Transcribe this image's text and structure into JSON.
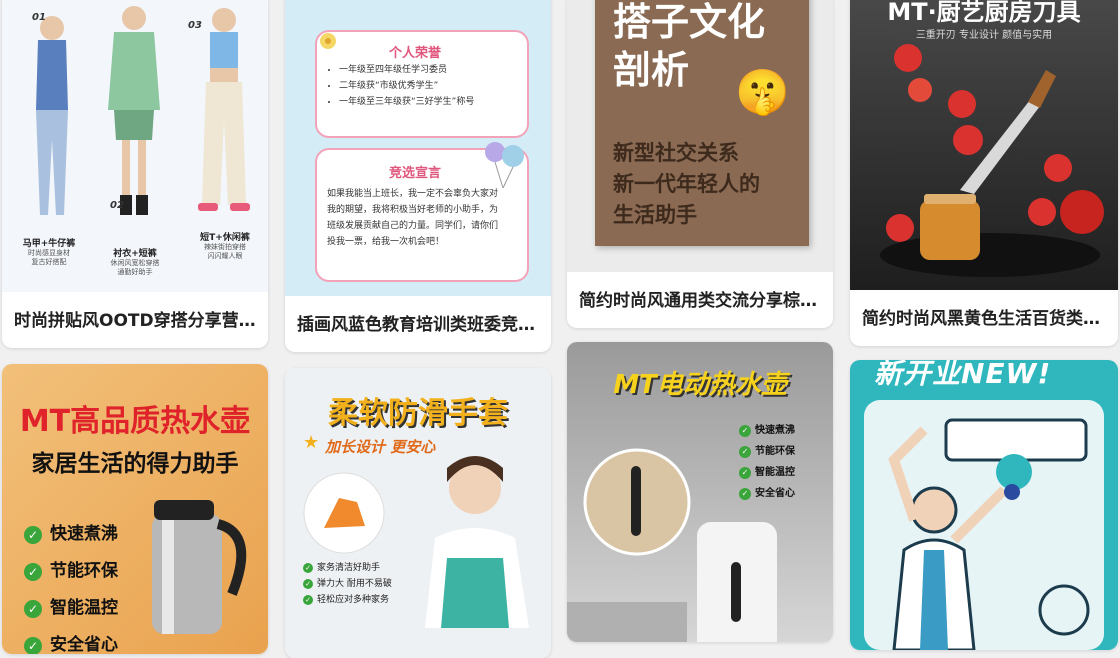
{
  "cards": [
    {
      "caption": "时尚拼贴风OOTD穿搭分享营…",
      "numbers": [
        "01",
        "02",
        "03"
      ],
      "labels": [
        {
          "title": "马甲+牛仔裤",
          "sub": "时尚感显身材\n复古好搭配"
        },
        {
          "title": "衬衣+短裤",
          "sub": "休闲风宽松穿搭\n通勤好助手"
        },
        {
          "title": "短T+休闲裤",
          "sub": "辣妹街拍穿搭\n闪闪耀人眼"
        }
      ]
    },
    {
      "caption": "插画风蓝色教育培训类班委竞…",
      "honor_title": "个人荣誉",
      "honors": [
        "一年级至四年级任学习委员",
        "二年级获“市级优秀学生”",
        "一年级至三年级获“三好学生”称号"
      ],
      "speech_title": "竞选宣言",
      "speech": "如果我能当上班长，我一定不会辜负大家对我的期望，我将积极当好老师的小助手，为班级发展贡献自己的力量。同学们，请你们投我一票，给我一次机会吧！"
    },
    {
      "caption": "简约时尚风通用类交流分享棕…",
      "headline": "搭子文化\n剖析",
      "sub": "新型社交关系\n新一代年轻人的\n生活助手",
      "emoji": "🤫"
    },
    {
      "caption": "简约时尚风黑黄色生活百货类…",
      "title": "MT·厨艺厨房刀具",
      "subtitle": "三重开刃 专业设计 颜值与实用"
    },
    {
      "title_line1": "MT高品质热水壶",
      "title_line2": "家居生活的得力助手",
      "features": [
        "快速煮沸",
        "节能环保",
        "智能温控",
        "安全省心"
      ]
    },
    {
      "title": "柔软防滑手套",
      "subtitle": "加长设计 更安心",
      "features": [
        "家务清洁好助手",
        "弹力大 耐用不易破",
        "轻松应对多种家务"
      ]
    },
    {
      "title": "MT电动热水壶",
      "features": [
        "快速煮沸",
        "节能环保",
        "智能温控",
        "安全省心"
      ]
    },
    {
      "title": "新开业NEW!"
    }
  ],
  "colors": {
    "page_bg": "#f0f0f1",
    "check_green": "#3aa53a",
    "brown": "#8a6a52",
    "teal": "#2fb7bd"
  }
}
